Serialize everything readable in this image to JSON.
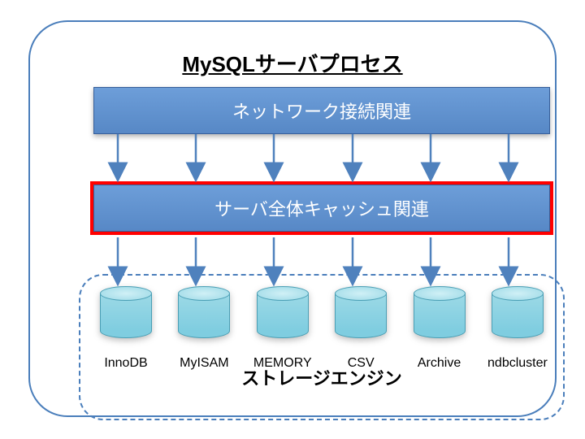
{
  "title": "MySQLサーバプロセス",
  "layers": {
    "network": "ネットワーク接続関連",
    "cache": "サーバ全体キャッシュ関連"
  },
  "storage": {
    "title": "ストレージエンジン",
    "engines": [
      "InnoDB",
      "MyISAM",
      "MEMORY",
      "CSV",
      "Archive",
      "ndbcluster"
    ]
  },
  "colors": {
    "box_fill_top": "#6d9ed9",
    "box_fill_bot": "#5788c6",
    "outline": "#4a7ebb",
    "highlight": "#ff0000",
    "arrow": "#4f81bd",
    "cylinder": "#9cd9e6"
  }
}
